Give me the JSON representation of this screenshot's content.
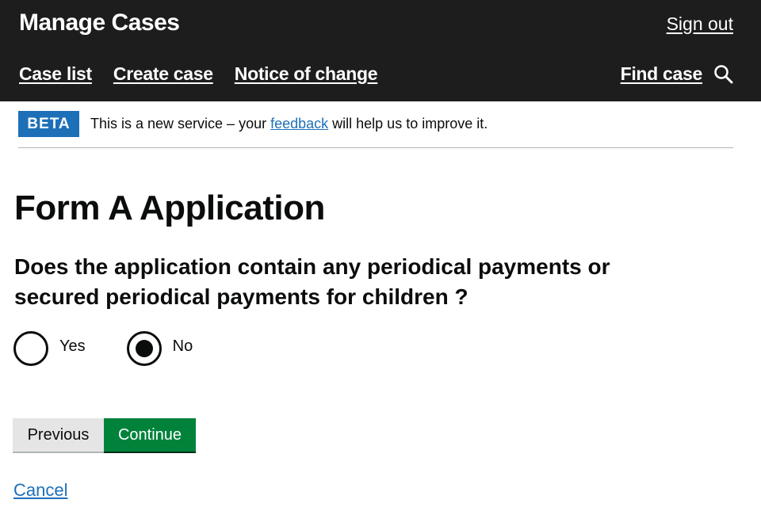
{
  "header": {
    "app_title": "Manage Cases",
    "sign_out": "Sign out",
    "nav": [
      {
        "label": "Case list"
      },
      {
        "label": "Create case"
      },
      {
        "label": "Notice of change"
      }
    ],
    "find_case": "Find case",
    "search_icon": "search-icon"
  },
  "phase_banner": {
    "tag": "BETA",
    "text_before": "This is a new service – your ",
    "link": "feedback",
    "text_after": " will help us to improve it."
  },
  "page": {
    "title": "Form A Application",
    "question": "Does the application contain any periodical payments or secured periodical payments for children ?",
    "options": [
      {
        "label": "Yes",
        "selected": false
      },
      {
        "label": "No",
        "selected": true
      }
    ]
  },
  "actions": {
    "previous": "Previous",
    "continue": "Continue",
    "cancel": "Cancel"
  },
  "colors": {
    "header_bg": "#1d1d1d",
    "beta_tag": "#1d70b8",
    "link": "#1d70b8",
    "primary_button": "#00823b",
    "secondary_button": "#e5e5e5"
  }
}
